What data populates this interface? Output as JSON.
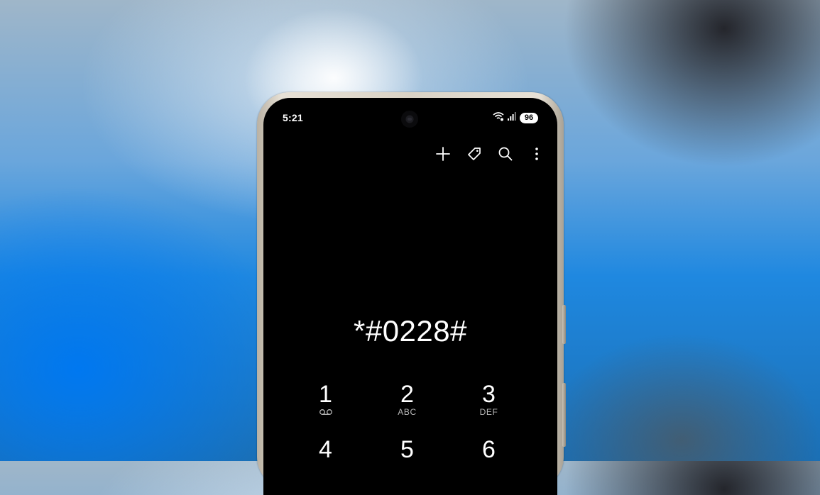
{
  "status_bar": {
    "time": "5:21",
    "battery": "96",
    "icons": [
      "wifi-calling-icon",
      "signal-icon"
    ]
  },
  "action_bar": {
    "icons": [
      "add-icon",
      "tag-icon",
      "search-icon",
      "more-vert-icon"
    ]
  },
  "dialed_number": "*#0228#",
  "keypad": {
    "keys": [
      {
        "digit": "1",
        "letters": "",
        "icon": "voicemail-icon"
      },
      {
        "digit": "2",
        "letters": "ABC"
      },
      {
        "digit": "3",
        "letters": "DEF"
      },
      {
        "digit": "4",
        "letters": ""
      },
      {
        "digit": "5",
        "letters": ""
      },
      {
        "digit": "6",
        "letters": ""
      }
    ]
  },
  "colors": {
    "screen_bg": "#000000",
    "text": "#ffffff",
    "subtext": "#b8b8b8",
    "phone_frame": "#d9d2c5"
  }
}
